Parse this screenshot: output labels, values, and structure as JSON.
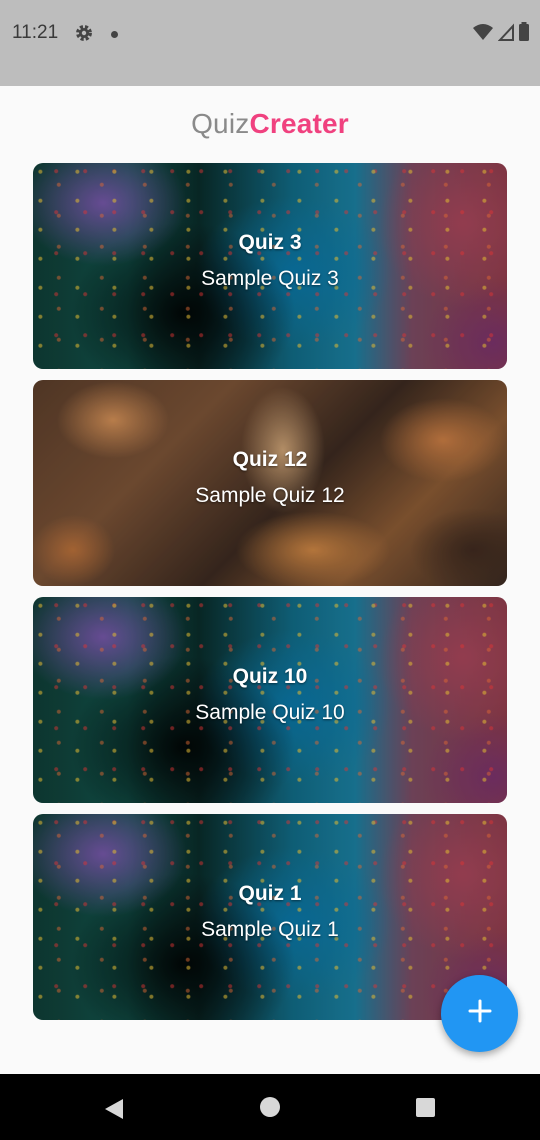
{
  "status_bar": {
    "time": "11:21",
    "icons": [
      "gear-icon",
      "notification-dot-icon",
      "wifi-icon",
      "signal-icon",
      "battery-icon"
    ]
  },
  "app": {
    "title_part1": "Quiz",
    "title_part2": "Creater",
    "title_color1": "#8a8a8a",
    "title_color2": "#f0417f"
  },
  "quizzes": [
    {
      "title": "Quiz 3",
      "description": "Sample Quiz 3",
      "background": "paint-splatter"
    },
    {
      "title": "Quiz 12",
      "description": "Sample Quiz 12",
      "background": "autumn-leaves"
    },
    {
      "title": "Quiz 10",
      "description": "Sample Quiz 10",
      "background": "paint-splatter"
    },
    {
      "title": "Quiz 1",
      "description": "Sample Quiz 1",
      "background": "paint-splatter"
    }
  ],
  "fab": {
    "icon": "plus-icon",
    "color": "#2196f3"
  },
  "nav_bar": {
    "icons": [
      "back-icon",
      "home-icon",
      "recents-icon"
    ]
  }
}
